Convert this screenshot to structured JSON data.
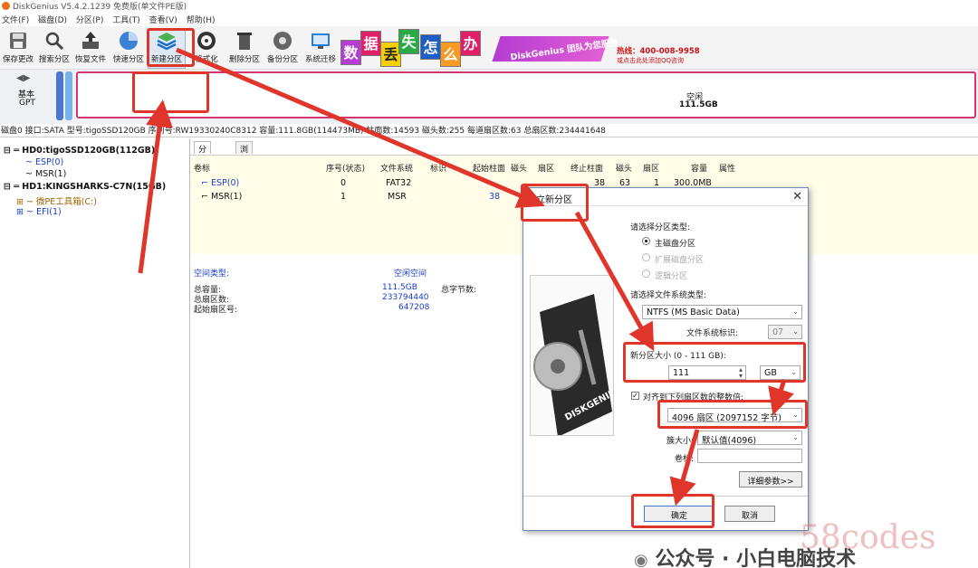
{
  "window": {
    "title": "DiskGenius V5.4.2.1239 免费版(单文件PE版)"
  },
  "menu": [
    "文件(F)",
    "磁盘(D)",
    "分区(P)",
    "工具(T)",
    "查看(V)",
    "帮助(H)"
  ],
  "toolbar": [
    {
      "label": "保存更改",
      "icon": "save-icon"
    },
    {
      "label": "搜索分区",
      "icon": "search-icon"
    },
    {
      "label": "恢复文件",
      "icon": "recover-icon"
    },
    {
      "label": "快速分区",
      "icon": "quick-partition-icon"
    },
    {
      "label": "新建分区",
      "icon": "new-partition-icon"
    },
    {
      "label": "格式化",
      "icon": "format-icon"
    },
    {
      "label": "删除分区",
      "icon": "delete-icon"
    },
    {
      "label": "备份分区",
      "icon": "backup-icon"
    },
    {
      "label": "系统迁移",
      "icon": "migrate-icon"
    }
  ],
  "banner": {
    "tiles": [
      "数",
      "据",
      "丢",
      "失",
      "怎",
      "么",
      "办"
    ],
    "ribbon": "DiskGenius 团队为您服务",
    "phone": "热线：400-008-9958",
    "qq": "或点击此处添加QQ咨询"
  },
  "disk_strip": {
    "type_line1": "基本",
    "type_line2": "GPT",
    "free_label": "空闲",
    "free_size": "111.5GB"
  },
  "disk_info": "磁盘0 接口:SATA  型号:tigoSSD120GB  序列号:RW19330240C8312  容量:111.8GB(114473MB)  柱面数:14593  磁头数:255  每道扇区数:63  总扇区数:234441648",
  "tree": [
    {
      "label": "HD0:tigoSSD120GB(112GB)",
      "level": 0
    },
    {
      "label": "ESP(0)",
      "level": 1
    },
    {
      "label": "MSR(1)",
      "level": 1
    },
    {
      "label": "HD1:KINGSHARKS-C7N(15GB)",
      "level": 0
    },
    {
      "label": "微PE工具箱(C:)",
      "level": 1
    },
    {
      "label": "EFI(1)",
      "level": 1
    }
  ],
  "tabs": [
    "分区参数",
    "浏览文件"
  ],
  "columns": [
    "卷标",
    "序号(状态)",
    "文件系统",
    "标识",
    "起始柱面",
    "磁头",
    "扇区",
    "终止柱面",
    "磁头",
    "扇区",
    "容量",
    "属性"
  ],
  "rows": [
    {
      "name": "ESP(0)",
      "num": "0",
      "fs": "FAT32",
      "start": "",
      "h1": "",
      "s1": "",
      "end": "38",
      "h2": "63",
      "s2": "1",
      "size": "300.0MB"
    },
    {
      "name": "MSR(1)",
      "num": "1",
      "fs": "MSR",
      "start": "38",
      "h1": "",
      "s1": "",
      "end": "",
      "h2": "",
      "s2": "",
      "size": ""
    }
  ],
  "free": {
    "type_label": "空间类型:",
    "type_value": "空闲空间",
    "total_label": "总容量:",
    "total_value": "111.5GB",
    "bytes_label": "总字节数:",
    "sectors_label": "总扇区数:",
    "sectors_value": "233794440",
    "start_label": "起始扇区号:",
    "start_value": "647208"
  },
  "dialog": {
    "title": "建立新分区",
    "type_label": "请选择分区类型:",
    "opt_primary": "主磁盘分区",
    "opt_extended": "扩展磁盘分区",
    "opt_logical": "逻辑分区",
    "fs_label": "请选择文件系统类型:",
    "fs_value": "NTFS (MS Basic Data)",
    "fsid_label": "文件系统标识:",
    "fsid_value": "07",
    "size_label": "新分区大小 (0 - 111 GB):",
    "size_value": "111",
    "size_unit": "GB",
    "align_label": "对齐到下列扇区数的整数倍:",
    "align_value": "4096 扇区 (2097152 字节)",
    "cluster_label": "簇大小:",
    "cluster_value": "默认值(4096)",
    "vol_label": "卷标:",
    "vol_value": "",
    "advanced": "详细参数>>",
    "ok": "确定",
    "cancel": "取消",
    "image_text": "DISKGENIUS"
  },
  "watermark": {
    "site": "58codes",
    "wechat": "公众号 · 小白电脑技术"
  }
}
